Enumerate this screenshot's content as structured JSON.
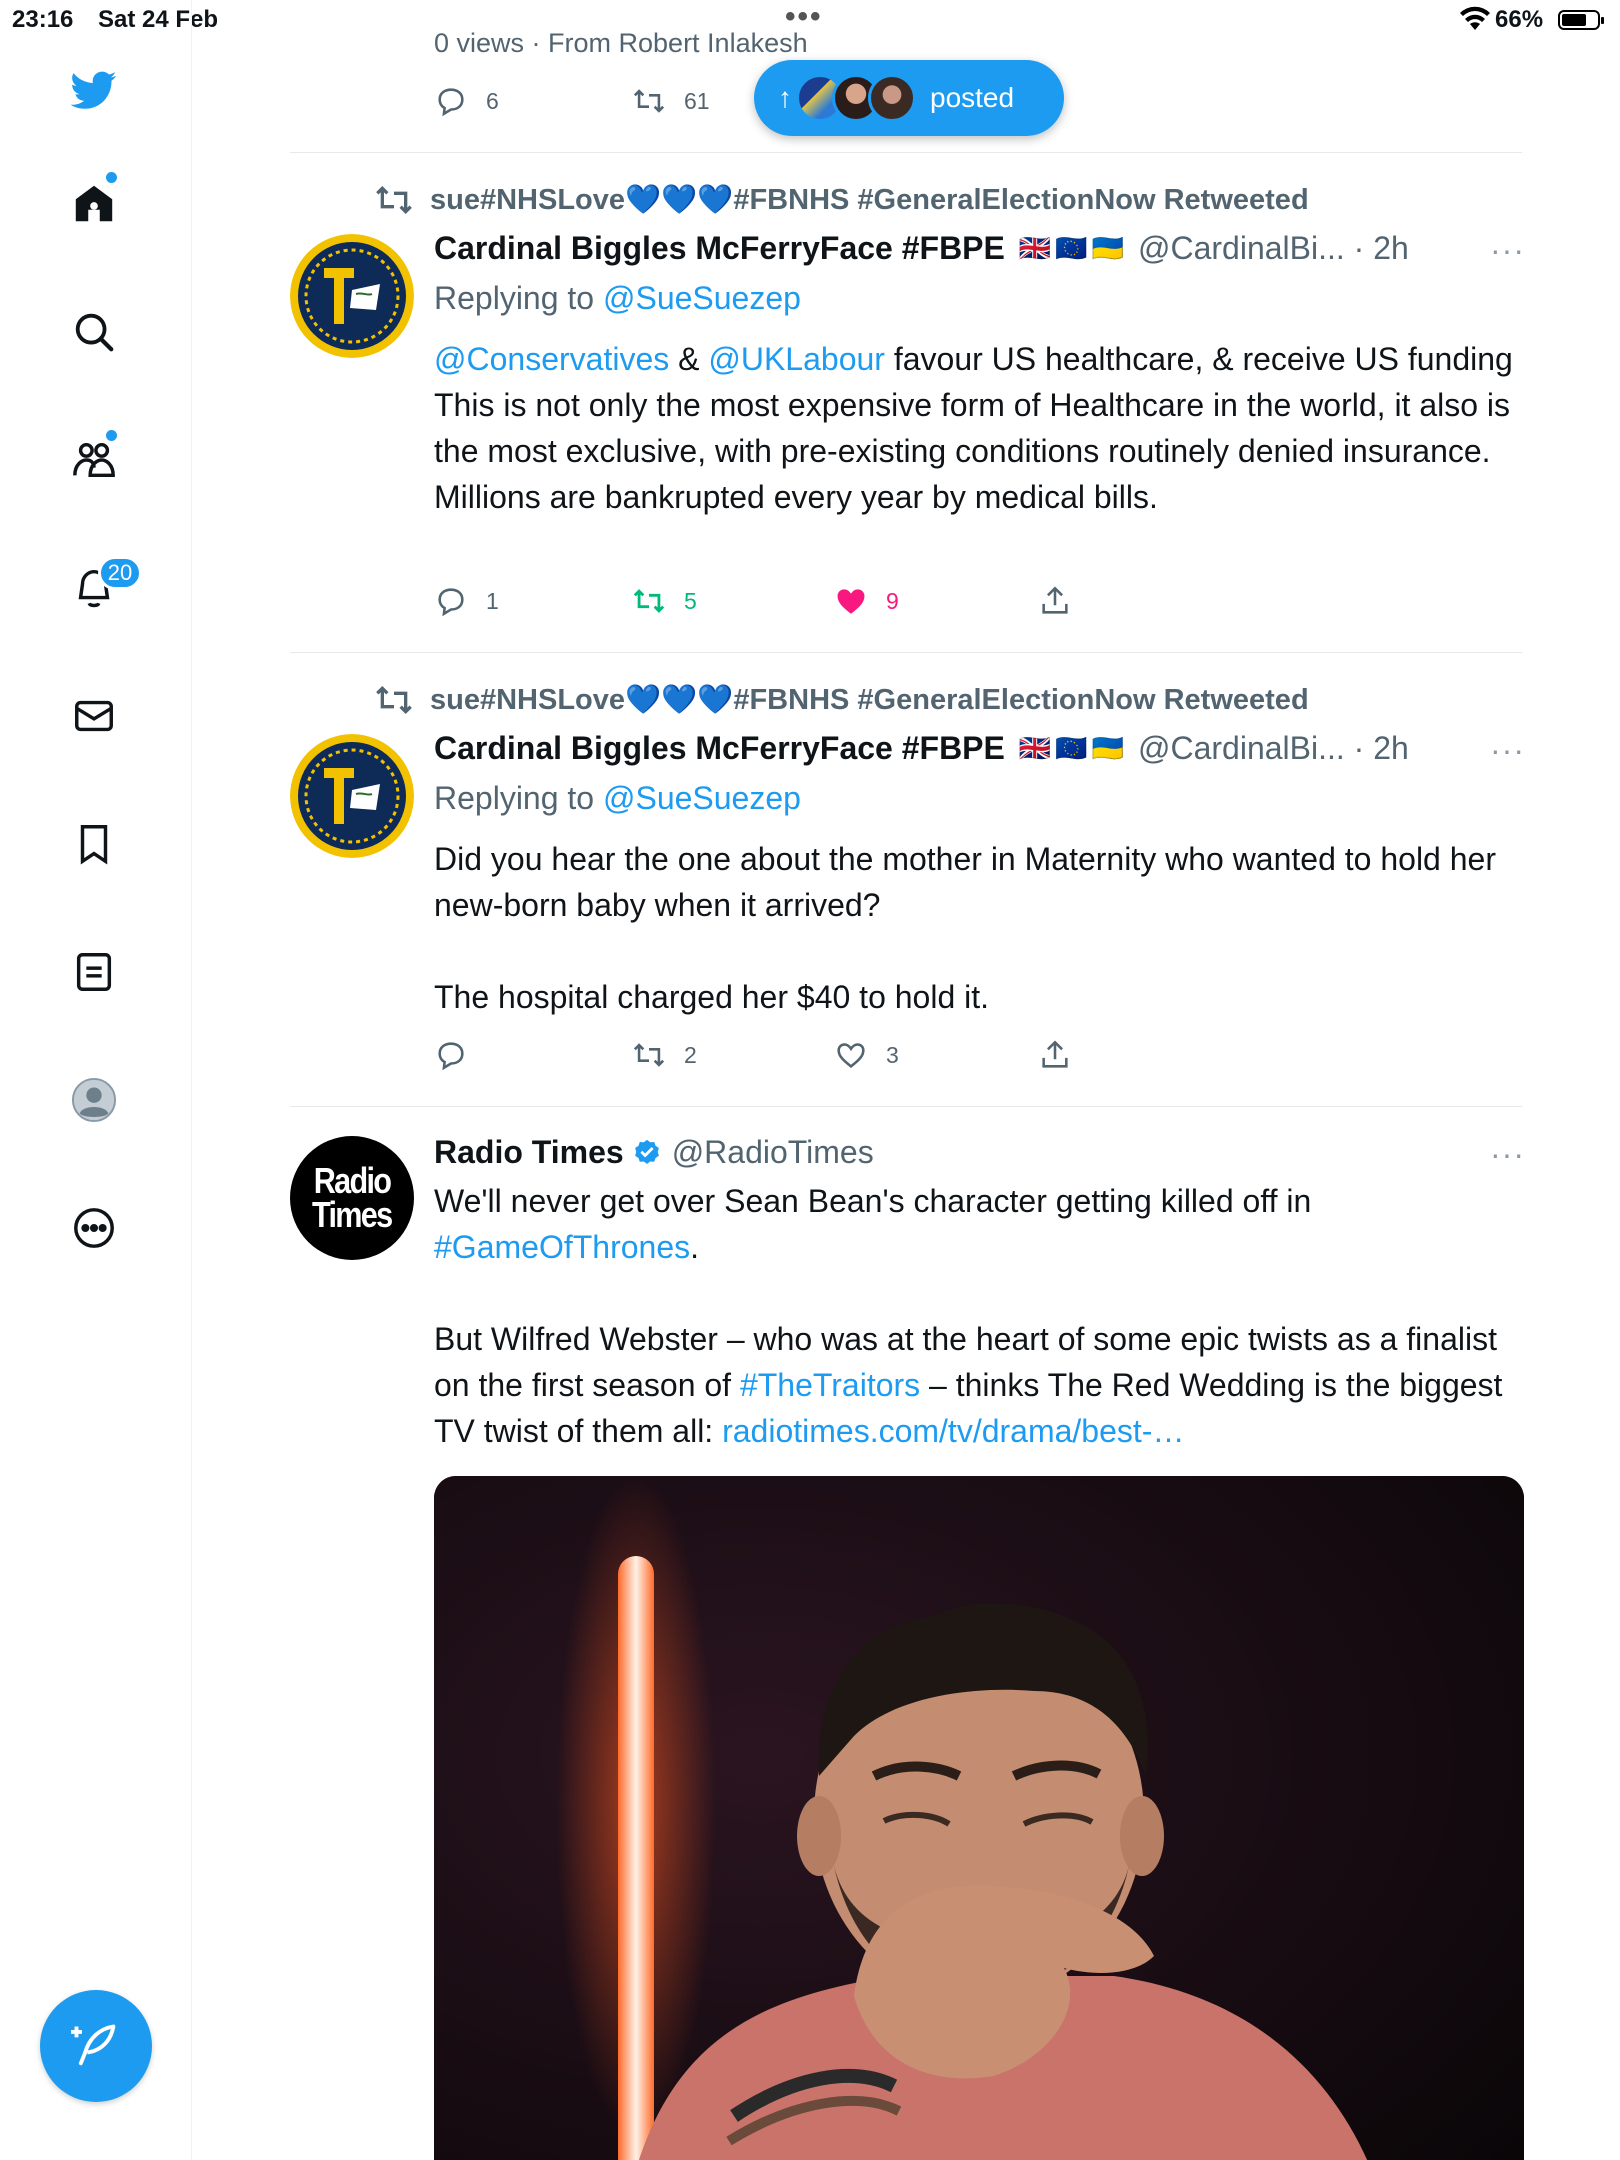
{
  "status_bar": {
    "time": "23:16",
    "date": "Sat 24 Feb",
    "battery": "66%",
    "battery_level": 0.66
  },
  "sidebar": {
    "icons": [
      "twitter-logo-icon",
      "home-icon",
      "search-icon",
      "communities-icon",
      "notifications-icon",
      "messages-icon",
      "bookmarks-icon",
      "lists-icon",
      "profile-icon",
      "more-icon"
    ],
    "notifications_badge": "20",
    "compose_icon": "compose-icon"
  },
  "top_tweet": {
    "meta": "0 views · From Robert Inlakesh",
    "replies": "6",
    "retweets": "61"
  },
  "posted_pill": {
    "label": "posted",
    "arrow": "↑"
  },
  "tweets": [
    {
      "retweeted_by": "sue#NHSLove💙💙💙#FBNHS #GeneralElectionNow Retweeted",
      "name": "Cardinal Biggles McFerryFace #FBPE",
      "flags": "🇬🇧🇪🇺🇺🇦",
      "handle_time": "@CardinalBi... · 2h",
      "more": "···",
      "replying_prefix": "Replying to ",
      "replying_handle": "@SueSuezep",
      "body_mention1": "@Conservatives",
      "body_amp": " & ",
      "body_mention2": "@UKLabour",
      "body_line1_rest": " favour US healthcare, & receive US funding",
      "body_rest": "This is not only the most expensive form of Healthcare in the world, it also is the most exclusive, with pre-existing conditions routinely denied insurance. Millions are bankrupted every year by medical bills.",
      "replies": "1",
      "retweets": "5",
      "likes": "9",
      "liked": true,
      "retweeted": true
    },
    {
      "retweeted_by": "sue#NHSLove💙💙💙#FBNHS #GeneralElectionNow Retweeted",
      "name": "Cardinal Biggles McFerryFace #FBPE",
      "flags": "🇬🇧🇪🇺🇺🇦",
      "handle_time": "@CardinalBi... · 2h",
      "more": "···",
      "replying_prefix": "Replying to ",
      "replying_handle": "@SueSuezep",
      "body_p1": "Did you hear the one about the mother in Maternity who wanted to hold her new-born baby when it arrived?",
      "body_p2": "The hospital charged her $40 to hold it.",
      "replies": "",
      "retweets": "2",
      "likes": "3"
    },
    {
      "name": "Radio Times",
      "handle": "@RadioTimes",
      "avatar_text_1": "Radio",
      "avatar_text_2": "Times",
      "more": "···",
      "body_p1_text": "We'll never get over Sean Bean's character getting killed off in ",
      "body_p1_hashtag": "#GameOfThrones",
      "body_p1_end": ".",
      "body_p2_a": "But Wilfred Webster – who was at the heart of some epic twists as a finalist on the first season of ",
      "body_p2_hashtag": "#TheTraitors",
      "body_p2_b": " – thinks The Red Wedding is the biggest TV twist of them all: ",
      "body_p2_link": "radiotimes.com/tv/drama/best-…"
    }
  ],
  "colors": {
    "accent": "#1d9bf0",
    "like": "#f91880",
    "retweet": "#00ba7c",
    "muted": "#536471"
  }
}
